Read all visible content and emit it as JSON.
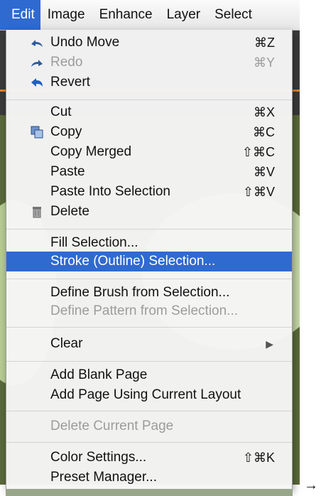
{
  "menubar": {
    "items": [
      "Edit",
      "Image",
      "Enhance",
      "Layer",
      "Select"
    ]
  },
  "menu": {
    "undo": {
      "label": "Undo Move",
      "shortcut": "⌘Z"
    },
    "redo": {
      "label": "Redo",
      "shortcut": "⌘Y"
    },
    "revert": {
      "label": "Revert"
    },
    "cut": {
      "label": "Cut",
      "shortcut": "⌘X"
    },
    "copy": {
      "label": "Copy",
      "shortcut": "⌘C"
    },
    "copy_merged": {
      "label": "Copy Merged",
      "shortcut": "⇧⌘C"
    },
    "paste": {
      "label": "Paste",
      "shortcut": "⌘V"
    },
    "paste_into": {
      "label": "Paste Into Selection",
      "shortcut": "⇧⌘V"
    },
    "delete": {
      "label": "Delete"
    },
    "fill": {
      "label": "Fill Selection..."
    },
    "stroke": {
      "label": "Stroke (Outline) Selection..."
    },
    "define_brush": {
      "label": "Define Brush from Selection..."
    },
    "define_pattern": {
      "label": "Define Pattern from Selection..."
    },
    "clear": {
      "label": "Clear"
    },
    "add_blank": {
      "label": "Add Blank Page"
    },
    "add_using_layout": {
      "label": "Add Page Using Current Layout"
    },
    "delete_page": {
      "label": "Delete Current Page"
    },
    "color_settings": {
      "label": "Color Settings...",
      "shortcut": "⇧⌘K"
    },
    "preset_manager": {
      "label": "Preset Manager..."
    }
  },
  "trailing_arrow": "→",
  "colors": {
    "highlight": "#2f6ad0",
    "disabled_text": "#9c9c9c"
  },
  "icons": [
    "undo-icon",
    "redo-icon",
    "revert-icon",
    "copy-icon",
    "trash-icon",
    "submenu-arrow-icon"
  ]
}
